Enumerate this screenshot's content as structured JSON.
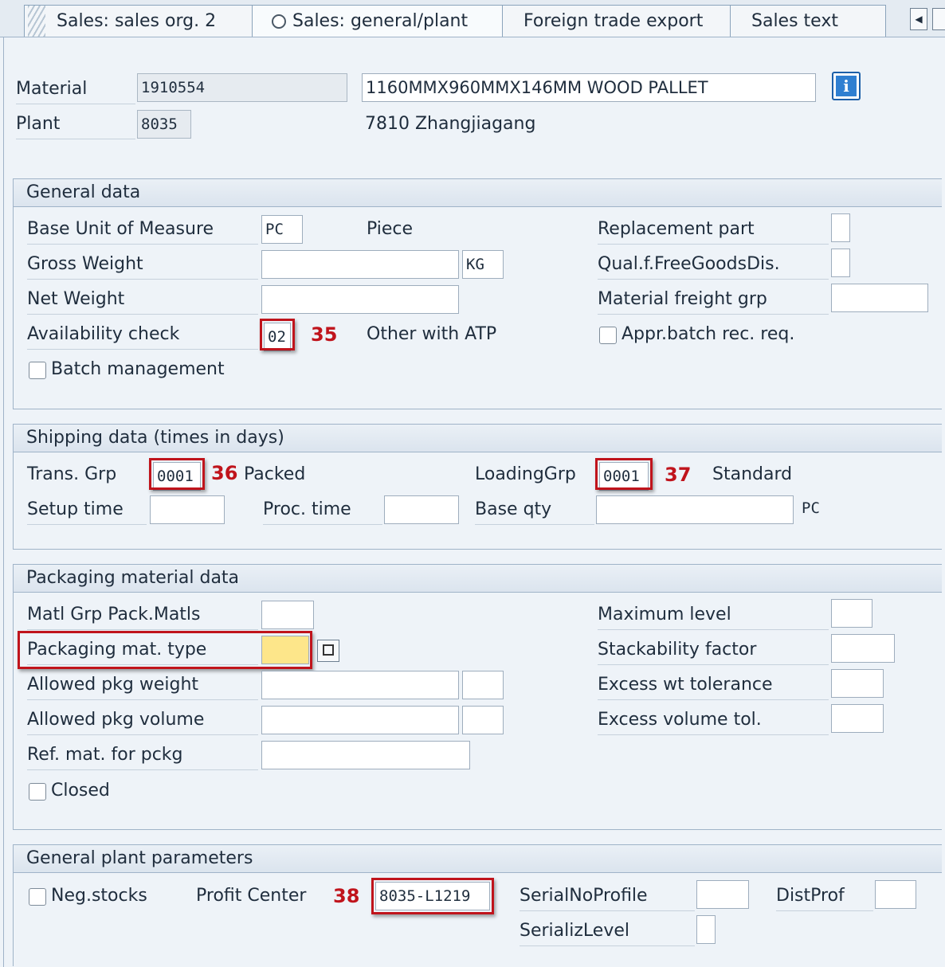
{
  "tabs": [
    {
      "label": "Sales: sales org. 2"
    },
    {
      "label": "Sales: general/plant"
    },
    {
      "label": "Foreign trade export"
    },
    {
      "label": "Sales text"
    }
  ],
  "header": {
    "material_label": "Material",
    "material_value": "1910554",
    "material_desc": "1160MMX960MMX146MM  WOOD  PALLET",
    "plant_label": "Plant",
    "plant_value": "8035",
    "plant_desc": "7810 Zhangjiagang"
  },
  "general_data": {
    "title": "General data",
    "base_uom_label": "Base Unit of Measure",
    "base_uom_value": "PC",
    "base_uom_text": "Piece",
    "gross_weight_label": "Gross Weight",
    "gross_weight_value": "",
    "weight_unit": "KG",
    "net_weight_label": "Net Weight",
    "net_weight_value": "",
    "avail_check_label": "Availability check",
    "avail_check_value": "02",
    "avail_check_marker": "35",
    "avail_check_text": "Other with ATP",
    "batch_mgmt_label": "Batch management",
    "replacement_part_label": "Replacement part",
    "qual_free_goods_label": "Qual.f.FreeGoodsDis.",
    "material_freight_label": "Material freight grp",
    "appr_batch_label": "Appr.batch rec. req."
  },
  "shipping_data": {
    "title": "Shipping data (times in days)",
    "trans_grp_label": "Trans. Grp",
    "trans_grp_value": "0001",
    "trans_grp_marker": "36",
    "trans_grp_text": "Packed",
    "loading_grp_label": "LoadingGrp",
    "loading_grp_value": "0001",
    "loading_grp_marker": "37",
    "loading_grp_text": "Standard",
    "setup_time_label": "Setup time",
    "proc_time_label": "Proc. time",
    "base_qty_label": "Base qty",
    "base_qty_unit": "PC"
  },
  "packaging_data": {
    "title": "Packaging material data",
    "matl_grp_label": "Matl Grp Pack.Matls",
    "pkg_mat_type_label": "Packaging mat. type",
    "allowed_weight_label": "Allowed pkg weight",
    "allowed_volume_label": "Allowed pkg volume",
    "ref_mat_label": "Ref. mat. for pckg",
    "closed_label": "Closed",
    "max_level_label": "Maximum level",
    "stackability_label": "Stackability factor",
    "excess_wt_label": "Excess wt tolerance",
    "excess_vol_label": "Excess volume tol."
  },
  "plant_params": {
    "title": "General plant parameters",
    "neg_stocks_label": "Neg.stocks",
    "profit_center_label": "Profit Center",
    "profit_center_marker": "38",
    "profit_center_value": "8035-L1219",
    "serial_profile_label": "SerialNoProfile",
    "dist_prof_label": "DistProf",
    "serializ_level_label": "SerializLevel"
  },
  "colors": {
    "marker_red": "#c0141c",
    "required_field": "#fde68a",
    "info_blue": "#2f7fd1"
  }
}
